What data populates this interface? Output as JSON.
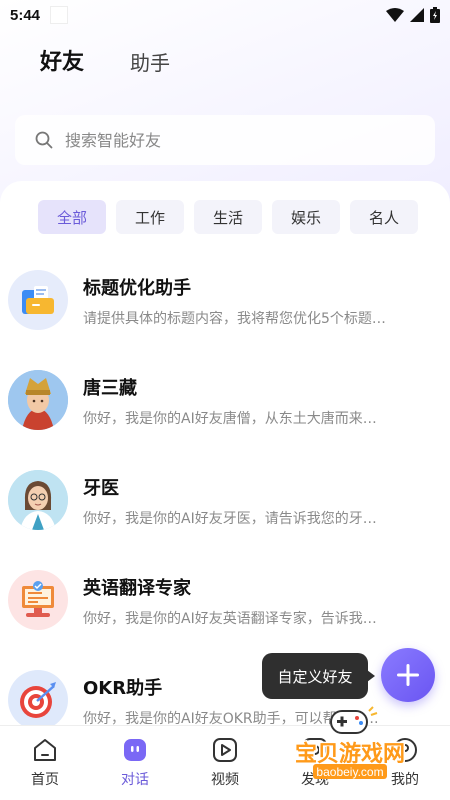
{
  "status": {
    "time": "5:44"
  },
  "top_tabs": [
    "好友",
    "助手"
  ],
  "search": {
    "placeholder": "搜索智能好友"
  },
  "chips": [
    "全部",
    "工作",
    "生活",
    "娱乐",
    "名人"
  ],
  "friends": [
    {
      "name": "标题优化助手",
      "desc": "请提供具体的标题内容，我将帮您优化5个标题…",
      "icon": "folder-icon"
    },
    {
      "name": "唐三藏",
      "desc": "你好，我是你的AI好友唐僧，从东土大唐而来…",
      "icon": "monk-avatar"
    },
    {
      "name": "牙医",
      "desc": "你好，我是你的AI好友牙医，请告诉我您的牙…",
      "icon": "dentist-avatar"
    },
    {
      "name": "英语翻译专家",
      "desc": "你好，我是你的AI好友英语翻译专家，告诉我…",
      "icon": "translator-icon"
    },
    {
      "name": "OKR助手",
      "desc": "你好，我是你的AI好友OKR助手，可以帮助你…",
      "icon": "target-icon"
    }
  ],
  "tooltip": "自定义好友",
  "fab_icon": "plus-icon",
  "bottom_nav": [
    "首页",
    "对话",
    "视频",
    "发现",
    "我的"
  ],
  "watermark": {
    "text": "宝贝游戏网",
    "url": "baobeiy.com"
  },
  "colors": {
    "accent": "#6b5bd9",
    "fab": "#7a68f5"
  }
}
